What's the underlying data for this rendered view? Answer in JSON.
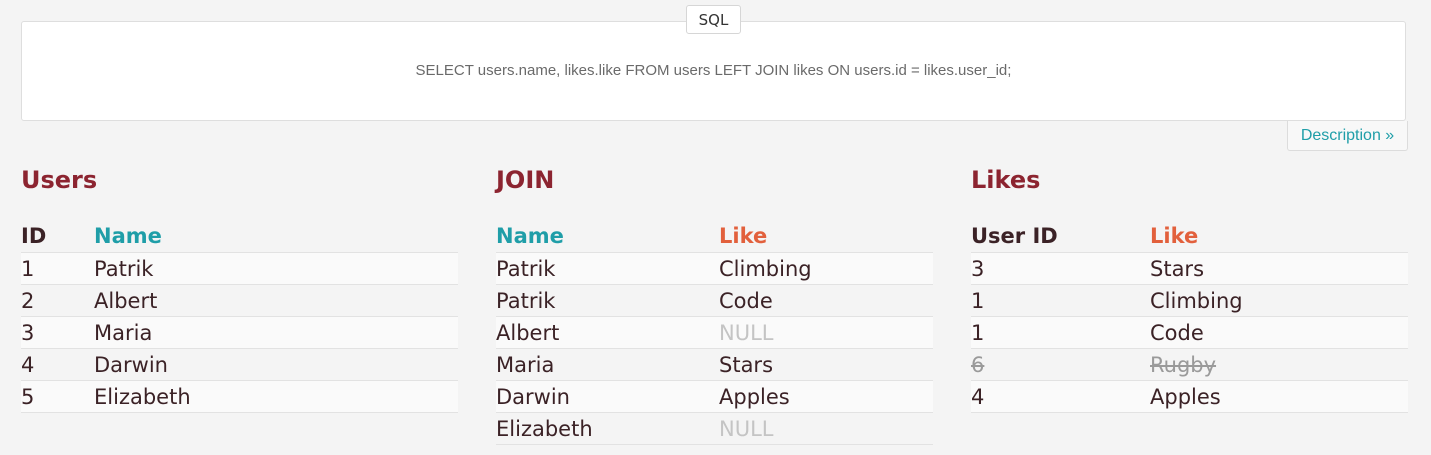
{
  "sql": {
    "tab_label": "SQL",
    "query": "SELECT users.name, likes.like FROM users LEFT JOIN likes ON users.id = likes.user_id;",
    "description_label": "Description »"
  },
  "users": {
    "title": "Users",
    "headers": [
      "ID",
      "Name"
    ],
    "rows": [
      [
        "1",
        "Patrik"
      ],
      [
        "2",
        "Albert"
      ],
      [
        "3",
        "Maria"
      ],
      [
        "4",
        "Darwin"
      ],
      [
        "5",
        "Elizabeth"
      ]
    ]
  },
  "join": {
    "title": "JOIN",
    "headers": [
      "Name",
      "Like"
    ],
    "rows": [
      [
        "Patrik",
        "Climbing"
      ],
      [
        "Patrik",
        "Code"
      ],
      [
        "Albert",
        "NULL"
      ],
      [
        "Maria",
        "Stars"
      ],
      [
        "Darwin",
        "Apples"
      ],
      [
        "Elizabeth",
        "NULL"
      ]
    ]
  },
  "likes": {
    "title": "Likes",
    "headers": [
      "User ID",
      "Like"
    ],
    "rows": [
      [
        "3",
        "Stars"
      ],
      [
        "1",
        "Climbing"
      ],
      [
        "1",
        "Code"
      ],
      [
        "6",
        "Rugby"
      ],
      [
        "4",
        "Apples"
      ]
    ]
  },
  "colors": {
    "title": "#8c2430",
    "teal": "#1f9ea8",
    "orange": "#e2603c",
    "null": "#c4c4c4"
  }
}
